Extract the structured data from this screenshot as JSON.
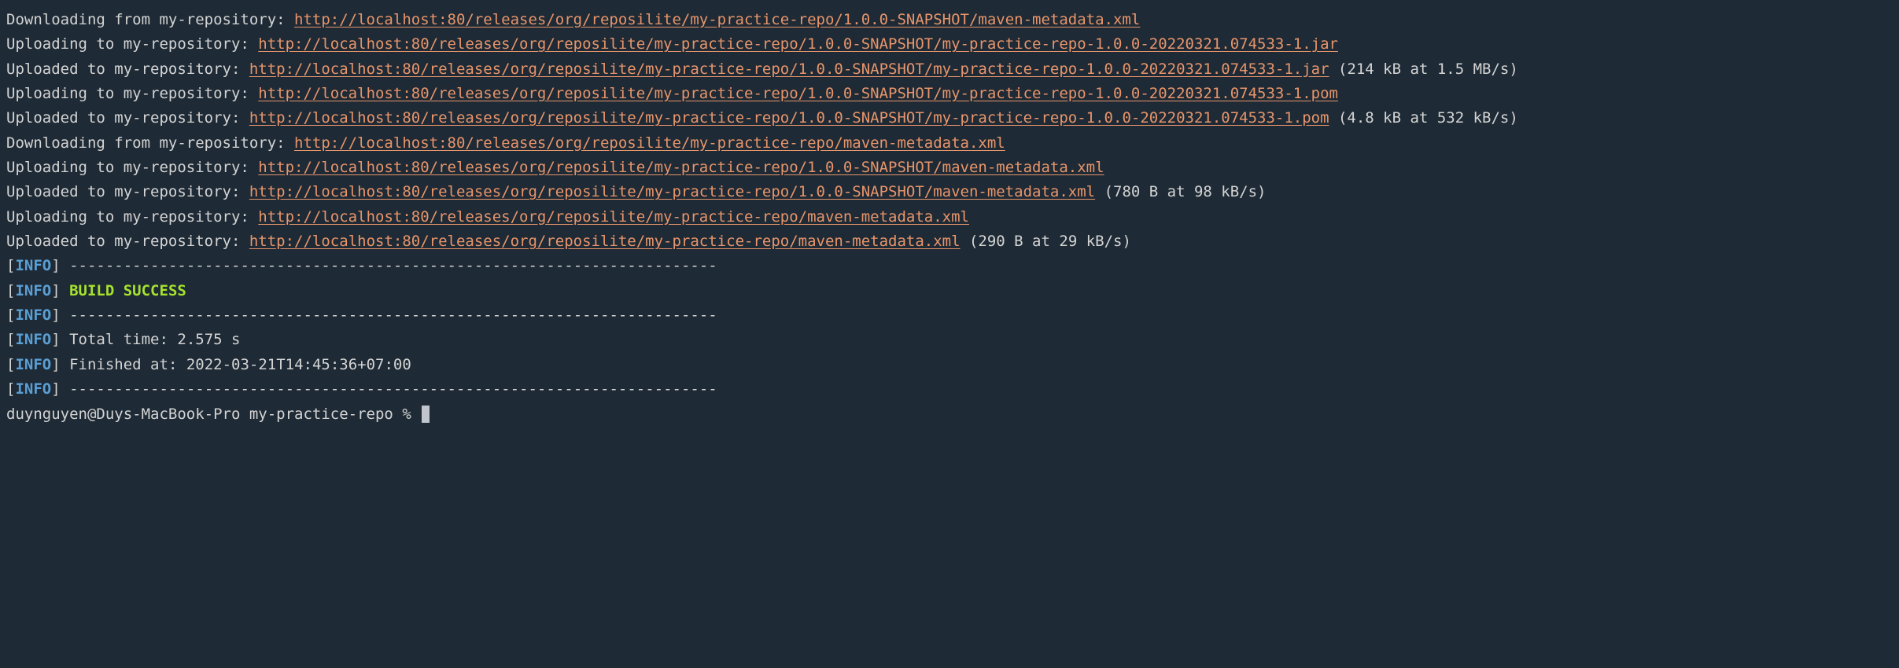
{
  "lines": [
    {
      "prefix": "Downloading from my-repository: ",
      "url": "http://localhost:80/releases/org/reposilite/my-practice-repo/1.0.0-SNAPSHOT/maven-metadata.xml",
      "suffix": ""
    },
    {
      "prefix": "Uploading to my-repository: ",
      "url": "http://localhost:80/releases/org/reposilite/my-practice-repo/1.0.0-SNAPSHOT/my-practice-repo-1.0.0-20220321.074533-1.jar",
      "suffix": ""
    },
    {
      "prefix": "Uploaded to my-repository: ",
      "url": "http://localhost:80/releases/org/reposilite/my-practice-repo/1.0.0-SNAPSHOT/my-practice-repo-1.0.0-20220321.074533-1.jar",
      "suffix": " (214 kB at 1.5 MB/s)"
    },
    {
      "prefix": "Uploading to my-repository: ",
      "url": "http://localhost:80/releases/org/reposilite/my-practice-repo/1.0.0-SNAPSHOT/my-practice-repo-1.0.0-20220321.074533-1.pom",
      "suffix": ""
    },
    {
      "prefix": "Uploaded to my-repository: ",
      "url": "http://localhost:80/releases/org/reposilite/my-practice-repo/1.0.0-SNAPSHOT/my-practice-repo-1.0.0-20220321.074533-1.pom",
      "suffix": " (4.8 kB at 532 kB/s)"
    },
    {
      "prefix": "Downloading from my-repository: ",
      "url": "http://localhost:80/releases/org/reposilite/my-practice-repo/maven-metadata.xml",
      "suffix": ""
    },
    {
      "prefix": "Uploading to my-repository: ",
      "url": "http://localhost:80/releases/org/reposilite/my-practice-repo/1.0.0-SNAPSHOT/maven-metadata.xml",
      "suffix": ""
    },
    {
      "prefix": "Uploaded to my-repository: ",
      "url": "http://localhost:80/releases/org/reposilite/my-practice-repo/1.0.0-SNAPSHOT/maven-metadata.xml",
      "suffix": " (780 B at 98 kB/s)"
    },
    {
      "prefix": "Uploading to my-repository: ",
      "url": "http://localhost:80/releases/org/reposilite/my-practice-repo/maven-metadata.xml",
      "suffix": ""
    },
    {
      "prefix": "Uploaded to my-repository: ",
      "url": "http://localhost:80/releases/org/reposilite/my-practice-repo/maven-metadata.xml",
      "suffix": " (290 B at 29 kB/s)"
    }
  ],
  "info_tag": "INFO",
  "divider": "------------------------------------------------------------------------",
  "build_success": "BUILD SUCCESS",
  "total_time_label": "Total time:  ",
  "total_time_value": "2.575 s",
  "finished_label": "Finished at: ",
  "finished_value": "2022-03-21T14:45:36+07:00",
  "prompt": "duynguyen@Duys-MacBook-Pro my-practice-repo % "
}
